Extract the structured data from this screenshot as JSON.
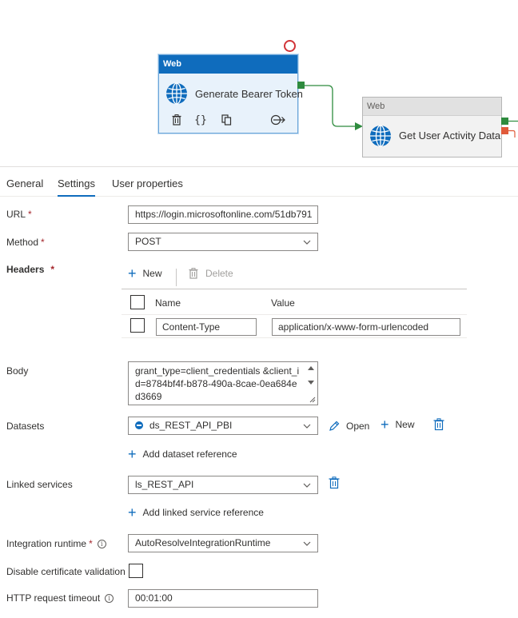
{
  "pipeline": {
    "activities": [
      {
        "type_label": "Web",
        "name": "Generate Bearer Token"
      },
      {
        "type_label": "Web",
        "name": "Get User Activity Data"
      }
    ]
  },
  "tabs": [
    {
      "label": "General"
    },
    {
      "label": "Settings"
    },
    {
      "label": "User properties"
    }
  ],
  "form": {
    "url": {
      "label": "URL",
      "required": "*",
      "value": "https://login.microsoftonline.com/51db791"
    },
    "method": {
      "label": "Method",
      "required": "*",
      "value": "POST"
    },
    "headers": {
      "label": "Headers",
      "required": "*",
      "new_label": "New",
      "delete_label": "Delete",
      "columns": [
        "Name",
        "Value"
      ],
      "rows": [
        {
          "name": "Content-Type",
          "value": "application/x-www-form-urlencoded"
        }
      ]
    },
    "body": {
      "label": "Body",
      "value": "grant_type=client_credentials &client_id=8784bf4f-b878-490a-8cae-0ea684ed3669"
    },
    "datasets": {
      "label": "Datasets",
      "value": "ds_REST_API_PBI",
      "open_label": "Open",
      "new_label": "New",
      "add_label": "Add dataset reference"
    },
    "linked_services": {
      "label": "Linked services",
      "value": "ls_REST_API",
      "add_label": "Add linked service reference"
    },
    "integration_runtime": {
      "label": "Integration runtime",
      "required": "*",
      "value": "AutoResolveIntegrationRuntime"
    },
    "disable_cert": {
      "label": "Disable certificate validation",
      "checked": false
    },
    "http_timeout": {
      "label": "HTTP request timeout",
      "value": "00:01:00"
    }
  },
  "colors": {
    "accent": "#0f6cbd",
    "success_port": "#2e8b3e",
    "failure_port": "#e05a3a",
    "error": "#d13438"
  }
}
